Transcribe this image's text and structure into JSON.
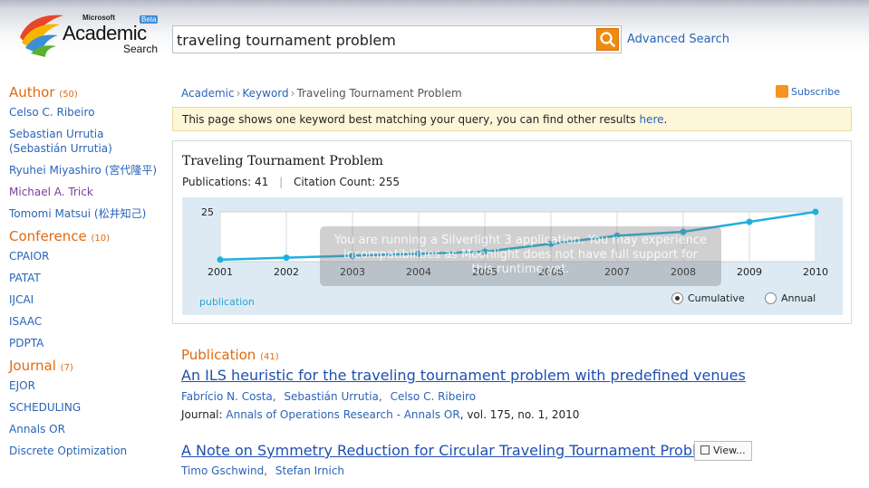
{
  "header": {
    "logo": {
      "ms": "Microsoft",
      "academic": "Academic",
      "search": "Search",
      "beta": "Beta"
    },
    "search_value": "traveling tournament problem",
    "advanced_search": "Advanced Search"
  },
  "sidebar": {
    "author": {
      "title": "Author",
      "count": "(50)",
      "items": [
        "Celso C. Ribeiro",
        "Sebastian Urrutia (Sebastián Urrutia)",
        "Ryuhei Miyashiro (宮代隆平)",
        "Michael A. Trick",
        "Tomomi Matsui (松井知己)"
      ]
    },
    "conference": {
      "title": "Conference",
      "count": "(10)",
      "items": [
        "CPAIOR",
        "PATAT",
        "IJCAI",
        "ISAAC",
        "PDPTA"
      ]
    },
    "journal": {
      "title": "Journal",
      "count": "(7)",
      "items": [
        "EJOR",
        "SCHEDULING",
        "Annals OR",
        "Discrete Optimization"
      ]
    }
  },
  "breadcrumb": {
    "items": [
      "Academic",
      "Keyword"
    ],
    "current": "Traveling Tournament Problem"
  },
  "subscribe": "Subscribe",
  "notice": {
    "text": "This page shows one keyword best matching your query, you can find other results ",
    "link": "here",
    "end": "."
  },
  "keyword": {
    "title": "Traveling Tournament Problem",
    "publications_label": "Publications:",
    "publications": "41",
    "citations_label": "Citation Count:",
    "citations": "255"
  },
  "chart": {
    "series_label": "publication",
    "cumulative": "Cumulative",
    "annual": "Annual",
    "overlay": "You are running a Silverlight 3 application. You may experience incompatibilities as Moonlight does not have full support for this runtime yet."
  },
  "chart_data": {
    "type": "line",
    "x": [
      "2001",
      "2002",
      "2003",
      "2004",
      "2005",
      "2006",
      "2007",
      "2008",
      "2009",
      "2010"
    ],
    "series": [
      {
        "name": "publication",
        "values": [
          1,
          2,
          3,
          4,
          5,
          9,
          13,
          15,
          20,
          25
        ]
      }
    ],
    "ylim": [
      0,
      25
    ],
    "ytick": "25",
    "grid": true,
    "mode": "Cumulative"
  },
  "publications": {
    "title": "Publication",
    "count": "(41)",
    "items": [
      {
        "title": "An ILS heuristic for the traveling tournament problem with predefined venues",
        "authors": [
          "Fabrício N. Costa",
          "Sebastián Urrutia",
          "Celso C. Ribeiro"
        ],
        "journal_label": "Journal:",
        "journal": "Annals of Operations Research - Annals OR",
        "details": ", vol. 175, no. 1, 2010"
      },
      {
        "title": "A Note on Symmetry Reduction for Circular Traveling Tournament Problems",
        "authors": [
          "Timo Gschwind",
          "Stefan Irnich"
        ],
        "view": "View..."
      }
    ]
  },
  "colors": {
    "accent": "#e06a10",
    "link": "#2a64b8",
    "series": "#1fb0dc"
  }
}
